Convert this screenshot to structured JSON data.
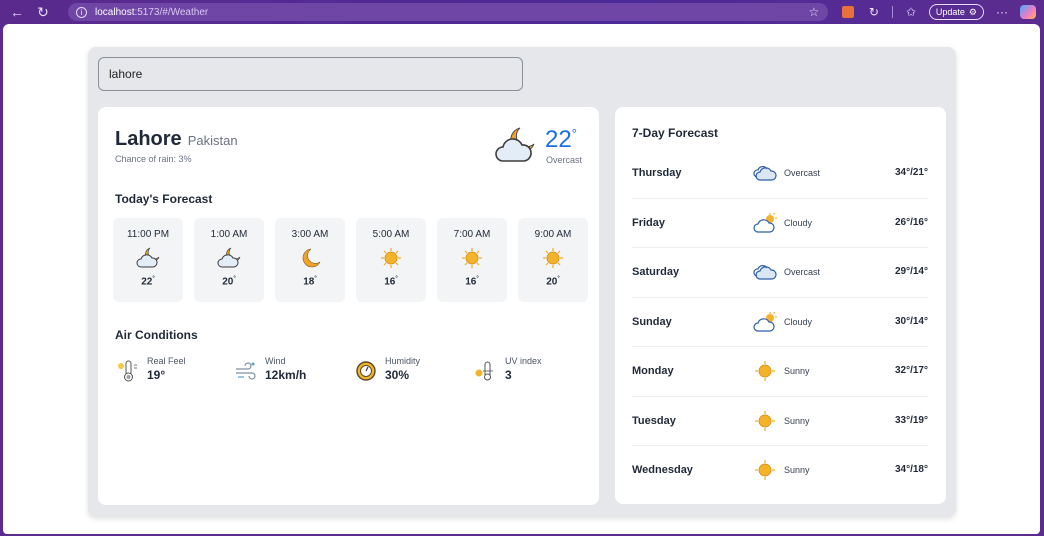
{
  "browser": {
    "url_host": "localhost",
    "url_path": ":5173/#/Weather",
    "update_label": "Update"
  },
  "search": {
    "value": "lahore"
  },
  "current": {
    "city": "Lahore",
    "country": "Pakistan",
    "rain": "Chance of rain: 3%",
    "temp": "22",
    "degree": "°",
    "description": "Overcast",
    "icon": "moon-cloud-icon"
  },
  "today": {
    "title": "Today's Forecast",
    "hours": [
      {
        "time": "11:00 PM",
        "temp": "22",
        "icon": "moon-cloud-icon"
      },
      {
        "time": "1:00 AM",
        "temp": "20",
        "icon": "moon-cloud-icon"
      },
      {
        "time": "3:00 AM",
        "temp": "18",
        "icon": "moon-icon"
      },
      {
        "time": "5:00 AM",
        "temp": "16",
        "icon": "sun-icon"
      },
      {
        "time": "7:00 AM",
        "temp": "16",
        "icon": "sun-icon"
      },
      {
        "time": "9:00 AM",
        "temp": "20",
        "icon": "sun-icon"
      }
    ],
    "degree": "°"
  },
  "air": {
    "title": "Air Conditions",
    "items": [
      {
        "label": "Real Feel",
        "value": "19°",
        "icon": "thermometer-icon"
      },
      {
        "label": "Wind",
        "value": "12km/h",
        "icon": "wind-icon"
      },
      {
        "label": "Humidity",
        "value": "30%",
        "icon": "humidity-icon"
      },
      {
        "label": "UV index",
        "value": "3",
        "icon": "uv-index-icon"
      }
    ]
  },
  "week": {
    "title": "7-Day Forecast",
    "days": [
      {
        "day": "Thursday",
        "desc": "Overcast",
        "temp": "34°/21°",
        "icon": "overcast-icon"
      },
      {
        "day": "Friday",
        "desc": "Cloudy",
        "temp": "26°/16°",
        "icon": "sun-cloud-icon"
      },
      {
        "day": "Saturday",
        "desc": "Overcast",
        "temp": "29°/14°",
        "icon": "overcast-icon"
      },
      {
        "day": "Sunday",
        "desc": "Cloudy",
        "temp": "30°/14°",
        "icon": "sun-cloud-icon"
      },
      {
        "day": "Monday",
        "desc": "Sunny",
        "temp": "32°/17°",
        "icon": "sun-icon"
      },
      {
        "day": "Tuesday",
        "desc": "Sunny",
        "temp": "33°/19°",
        "icon": "sun-icon"
      },
      {
        "day": "Wednesday",
        "desc": "Sunny",
        "temp": "34°/18°",
        "icon": "sun-icon"
      }
    ]
  },
  "colors": {
    "accent_temp": "#1d6fe0",
    "panel_bg": "#e5e7eb",
    "browser_frame": "#5b2c8f",
    "sun": "#f5a623",
    "moon": "#f0a32a"
  }
}
